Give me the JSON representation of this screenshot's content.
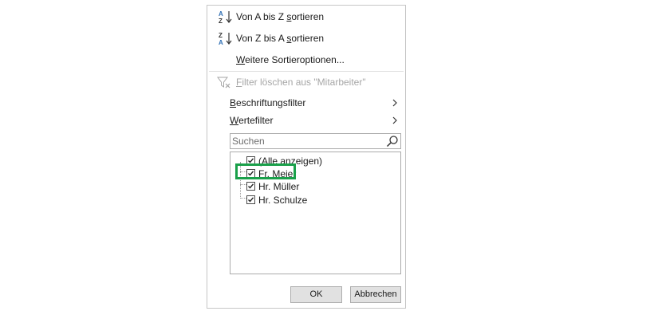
{
  "menu": {
    "sort_az": {
      "pre": "Von A bis Z ",
      "key": "s",
      "post": "ortieren",
      "icon": "sort-ascending-icon"
    },
    "sort_za": {
      "pre": "Von Z bis A ",
      "key": "s",
      "post": "ortieren",
      "icon": "sort-descending-icon"
    },
    "more_sort": {
      "pre": "",
      "key": "W",
      "post": "eitere Sortieroptionen..."
    },
    "clear_filter": {
      "pre": "",
      "key": "F",
      "post": "ilter löschen aus \"Mitarbeiter\"",
      "icon": "clear-filter-icon",
      "disabled": true
    },
    "label_filter": {
      "pre": "",
      "key": "B",
      "post": "eschriftungsfilter",
      "icon": "chevron-right-icon"
    },
    "value_filter": {
      "pre": "",
      "key": "W",
      "post": "ertefilter",
      "icon": "chevron-right-icon"
    }
  },
  "search": {
    "placeholder": "Suchen",
    "value": "",
    "icon": "search-icon"
  },
  "list": {
    "items": [
      {
        "label": "(Alle anzeigen)",
        "checked": true
      },
      {
        "label": "Fr. Meier",
        "checked": true,
        "highlighted": true
      },
      {
        "label": "Hr. Müller",
        "checked": true
      },
      {
        "label": "Hr. Schulze",
        "checked": true
      }
    ]
  },
  "buttons": {
    "ok": "OK",
    "cancel": "Abbrechen"
  },
  "colors": {
    "highlight": "#1aa04a",
    "disabled_text": "#a6a6a6",
    "sort_icon_blue": "#2f6fb5"
  }
}
